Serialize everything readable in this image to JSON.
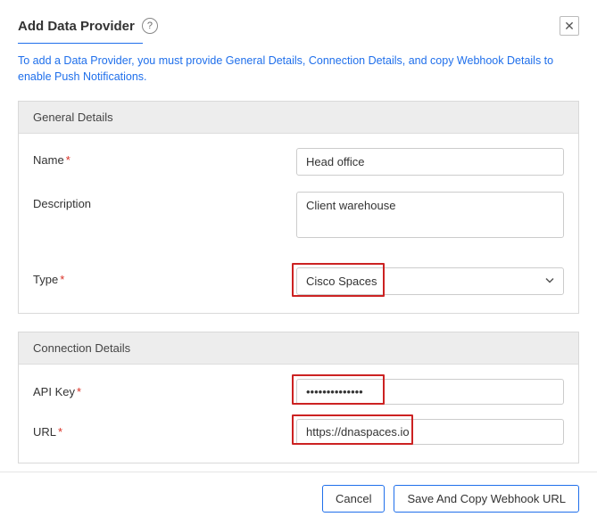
{
  "header": {
    "title": "Add Data Provider",
    "help_glyph": "?",
    "close_glyph": "✕"
  },
  "info_text": "To add a Data Provider, you must provide General Details, Connection Details, and copy Webhook Details to enable Push Notifications.",
  "general": {
    "section_title": "General Details",
    "name_label": "Name",
    "name_value": "Head office",
    "description_label": "Description",
    "description_value": "Client warehouse",
    "type_label": "Type",
    "type_value": "Cisco Spaces"
  },
  "connection": {
    "section_title": "Connection Details",
    "apikey_label": "API Key",
    "apikey_value": "••••••••••••••",
    "url_label": "URL",
    "url_value": "https://dnaspaces.io"
  },
  "footer": {
    "cancel": "Cancel",
    "save": "Save And Copy Webhook URL"
  }
}
